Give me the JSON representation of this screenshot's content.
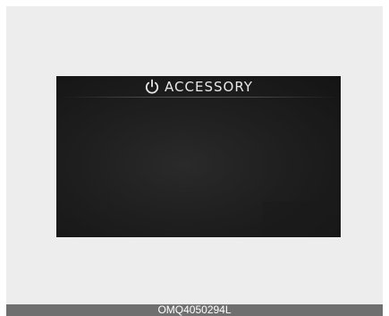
{
  "display": {
    "icon": "power-icon",
    "title": "ACCESSORY"
  },
  "footer": {
    "code": "OMQ4050294L"
  },
  "colors": {
    "frame_background": "#ededed",
    "screen_background": "#1f1f1f",
    "footer_background": "#6f6f6f",
    "text": "#e8e8e8"
  }
}
